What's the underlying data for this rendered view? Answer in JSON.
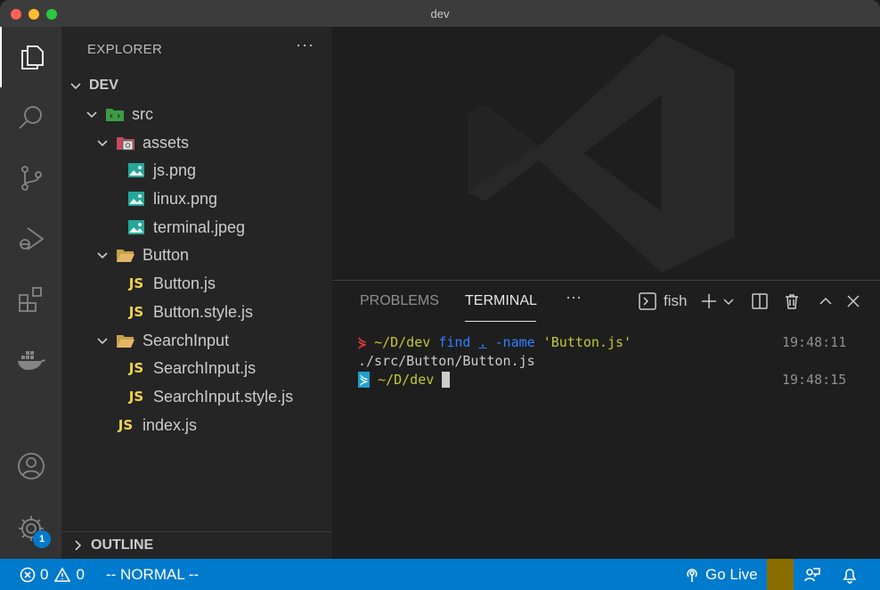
{
  "window": {
    "title": "dev"
  },
  "activity_bar": {
    "items": [
      {
        "name": "explorer-icon",
        "active": true
      },
      {
        "name": "search-icon",
        "active": false
      },
      {
        "name": "source-control-icon",
        "active": false
      },
      {
        "name": "run-debug-icon",
        "active": false
      },
      {
        "name": "extensions-icon",
        "active": false
      },
      {
        "name": "docker-icon",
        "active": false
      }
    ],
    "accounts": "account-icon",
    "settings_badge": "1"
  },
  "sidebar": {
    "header": "EXPLORER",
    "more": "···",
    "root": "DEV",
    "tree": [
      {
        "label": "src",
        "type": "folder-src"
      },
      {
        "label": "assets",
        "type": "folder-assets"
      },
      {
        "label": "js.png",
        "type": "image"
      },
      {
        "label": "linux.png",
        "type": "image"
      },
      {
        "label": "terminal.jpeg",
        "type": "image"
      },
      {
        "label": "Button",
        "type": "folder"
      },
      {
        "label": "Button.js",
        "type": "js"
      },
      {
        "label": "Button.style.js",
        "type": "js"
      },
      {
        "label": "SearchInput",
        "type": "folder"
      },
      {
        "label": "SearchInput.js",
        "type": "js"
      },
      {
        "label": "SearchInput.style.js",
        "type": "js"
      },
      {
        "label": "index.js",
        "type": "js"
      }
    ],
    "js_badge": "JS",
    "outline": "OUTLINE"
  },
  "panel": {
    "tabs": {
      "problems": "PROBLEMS",
      "terminal": "TERMINAL",
      "more": "···"
    },
    "shell": "fish",
    "terminal": {
      "line1": {
        "path": "~/D/dev",
        "cmd": "find",
        "dot": ".",
        "flag": "-name",
        "arg": "'Button.js'",
        "time": "19:48:11"
      },
      "line2": "./src/Button/Button.js",
      "line3": {
        "path": "~/D/dev",
        "time": "19:48:15"
      }
    }
  },
  "status_bar": {
    "errors": "0",
    "warnings": "0",
    "mode": "-- NORMAL --",
    "go_live": "Go Live"
  },
  "colors": {
    "accent": "#007acc",
    "js": "#f0d54b",
    "sidebar_bg": "#252526",
    "activity_bg": "#333333",
    "editor_bg": "#1e1e1e"
  }
}
